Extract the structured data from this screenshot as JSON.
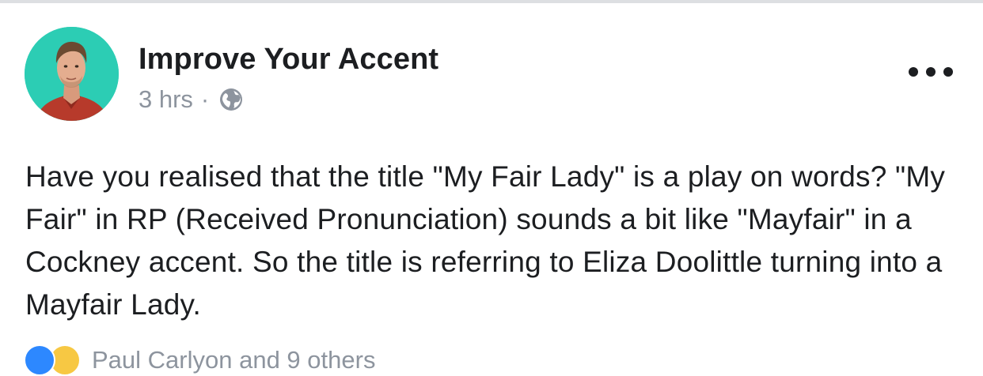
{
  "post": {
    "page_name": "Improve Your Accent",
    "timestamp": "3 hrs",
    "separator": "·",
    "privacy_icon": "globe-icon",
    "more_icon": "more-options-icon",
    "text": "Have you realised that the title \"My Fair Lady\" is a play on words? \"My Fair\" in RP (Received Pronunciation) sounds a bit like \"Mayfair\" in a Cockney accent. So the title is referring to Eliza Doolittle turning into a Mayfair Lady.",
    "reactions": {
      "icons": [
        "like-icon",
        "haha-icon"
      ],
      "reactors_text": "Paul Carlyon and 9 others"
    }
  },
  "colors": {
    "avatar_background": "#2ccdb4",
    "primary_text": "#1c1e21",
    "secondary_text": "#8d949e",
    "like_blue": "#2d88ff",
    "haha_yellow": "#f7c843"
  }
}
